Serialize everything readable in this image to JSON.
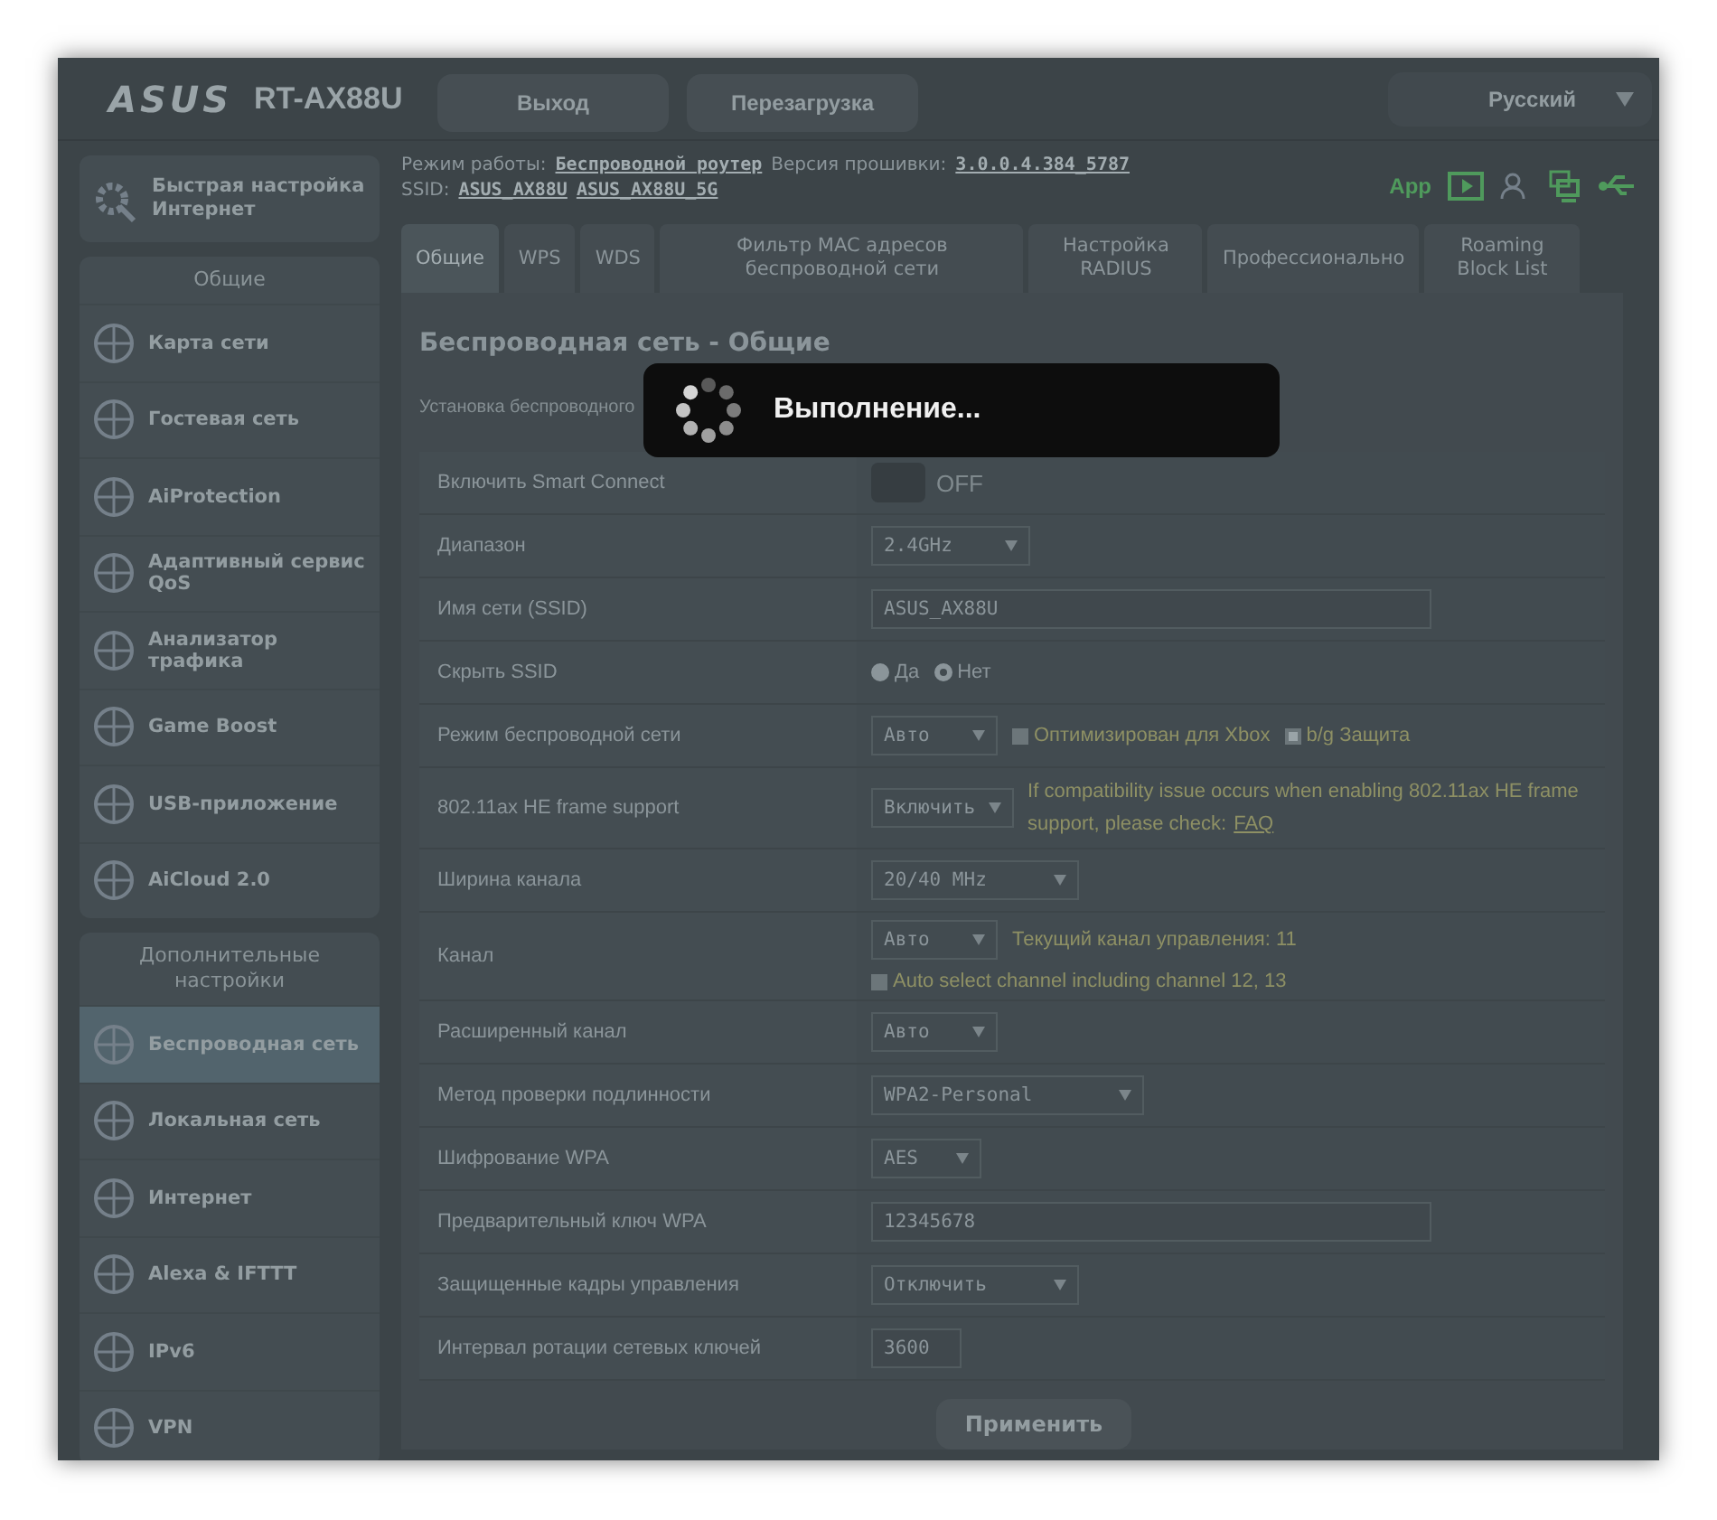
{
  "header": {
    "logo": "ASUS",
    "model": "RT-AX88U",
    "buttons": [
      "Выход",
      "Перезагрузка"
    ],
    "language": "Русский"
  },
  "quick_setup": "Быстрая настройка Интернет",
  "sidebar": {
    "sections": [
      {
        "title": "Общие",
        "items": [
          {
            "label": "Карта сети",
            "selected": false
          },
          {
            "label": "Гостевая сеть",
            "selected": false
          },
          {
            "label": "AiProtection",
            "selected": false
          },
          {
            "label": "Адаптивный сервис QoS",
            "selected": false
          },
          {
            "label": "Анализатор трафика",
            "selected": false
          },
          {
            "label": "Game Boost",
            "selected": false
          },
          {
            "label": "USB-приложение",
            "selected": false
          },
          {
            "label": "AiCloud 2.0",
            "selected": false
          }
        ]
      },
      {
        "title": "Дополнительные настройки",
        "items": [
          {
            "label": "Беспроводная сеть",
            "selected": true
          },
          {
            "label": "Локальная сеть",
            "selected": false
          },
          {
            "label": "Интернет",
            "selected": false
          },
          {
            "label": "Alexa & IFTTT",
            "selected": false
          },
          {
            "label": "IPv6",
            "selected": false
          },
          {
            "label": "VPN",
            "selected": false
          }
        ]
      }
    ]
  },
  "info": {
    "mode_label": "Режим работы:",
    "mode": "Беспроводной роутер",
    "firmware_label": "Версия прошивки:",
    "firmware": "3.0.0.4.384_5787",
    "ssid_label": "SSID:",
    "ssids": [
      "ASUS_AX88U",
      "ASUS_AX88U_5G"
    ],
    "app": "App"
  },
  "tabs": [
    {
      "label": "Общие",
      "selected": true
    },
    {
      "label": "WPS",
      "selected": false
    },
    {
      "label": "WDS",
      "selected": false
    },
    {
      "label": "Фильтр MAC адресов беспроводной сети",
      "selected": false
    },
    {
      "label": "Настройка RADIUS",
      "selected": false
    },
    {
      "label": "Профессионально",
      "selected": false
    },
    {
      "label": "Roaming Block List",
      "selected": false
    }
  ],
  "panel": {
    "title": "Беспроводная сеть - Общие",
    "description": "Установка беспроводного",
    "rows": [
      {
        "label": "Включить Smart Connect",
        "lines": [
          [
            {
              "kind": "toggle",
              "on": false,
              "text": "OFF"
            }
          ]
        ]
      },
      {
        "label": "Диапазон",
        "lines": [
          [
            {
              "kind": "select",
              "value": "2.4GHz"
            }
          ]
        ]
      },
      {
        "label": "Имя сети (SSID)",
        "lines": [
          [
            {
              "kind": "input",
              "value": "ASUS_AX88U"
            }
          ]
        ]
      },
      {
        "label": "Скрыть SSID",
        "lines": [
          [
            {
              "kind": "radio",
              "text": "Да",
              "selected": false
            },
            {
              "kind": "radio",
              "text": "Нет",
              "selected": true
            }
          ]
        ]
      },
      {
        "label": "Режим беспроводной сети",
        "lines": [
          [
            {
              "kind": "select",
              "value": "Авто"
            },
            {
              "kind": "checkbox",
              "text": "Оптимизирован для Xbox",
              "checked": false
            },
            {
              "kind": "checkbox",
              "text": "b/g Защита",
              "checked": true
            }
          ]
        ]
      },
      {
        "label": "802.11ax HE frame support",
        "lines": [
          [
            {
              "kind": "select",
              "value": "Включить"
            },
            {
              "kind": "note",
              "text": "If compatibility issue occurs when enabling 802.11ax HE frame support, please check:",
              "link": "FAQ"
            }
          ]
        ]
      },
      {
        "label": "Ширина канала",
        "lines": [
          [
            {
              "kind": "select",
              "value": "20/40 MHz"
            }
          ]
        ]
      },
      {
        "label": "Канал",
        "lines": [
          [
            {
              "kind": "select",
              "value": "Авто"
            },
            {
              "kind": "note",
              "text": "Текущий канал управления: 11"
            }
          ],
          [
            {
              "kind": "checkbox",
              "text": "Auto select channel including channel 12, 13",
              "checked": false
            }
          ]
        ]
      },
      {
        "label": "Расширенный канал",
        "lines": [
          [
            {
              "kind": "select",
              "value": "Авто"
            }
          ]
        ]
      },
      {
        "label": "Метод проверки подлинности",
        "lines": [
          [
            {
              "kind": "select",
              "value": "WPA2-Personal"
            }
          ]
        ]
      },
      {
        "label": "Шифрование WPA",
        "lines": [
          [
            {
              "kind": "select",
              "value": "AES"
            }
          ]
        ]
      },
      {
        "label": "Предварительный ключ WPA",
        "lines": [
          [
            {
              "kind": "input",
              "value": "12345678"
            }
          ]
        ]
      },
      {
        "label": "Защищенные кадры управления",
        "lines": [
          [
            {
              "kind": "select",
              "value": "Отключить"
            }
          ]
        ]
      },
      {
        "label": "Интервал ротации сетевых ключей",
        "lines": [
          [
            {
              "kind": "input",
              "value": "3600",
              "short": true
            }
          ]
        ]
      }
    ],
    "apply": "Применить"
  },
  "dialog": {
    "text": "Выполнение..."
  }
}
